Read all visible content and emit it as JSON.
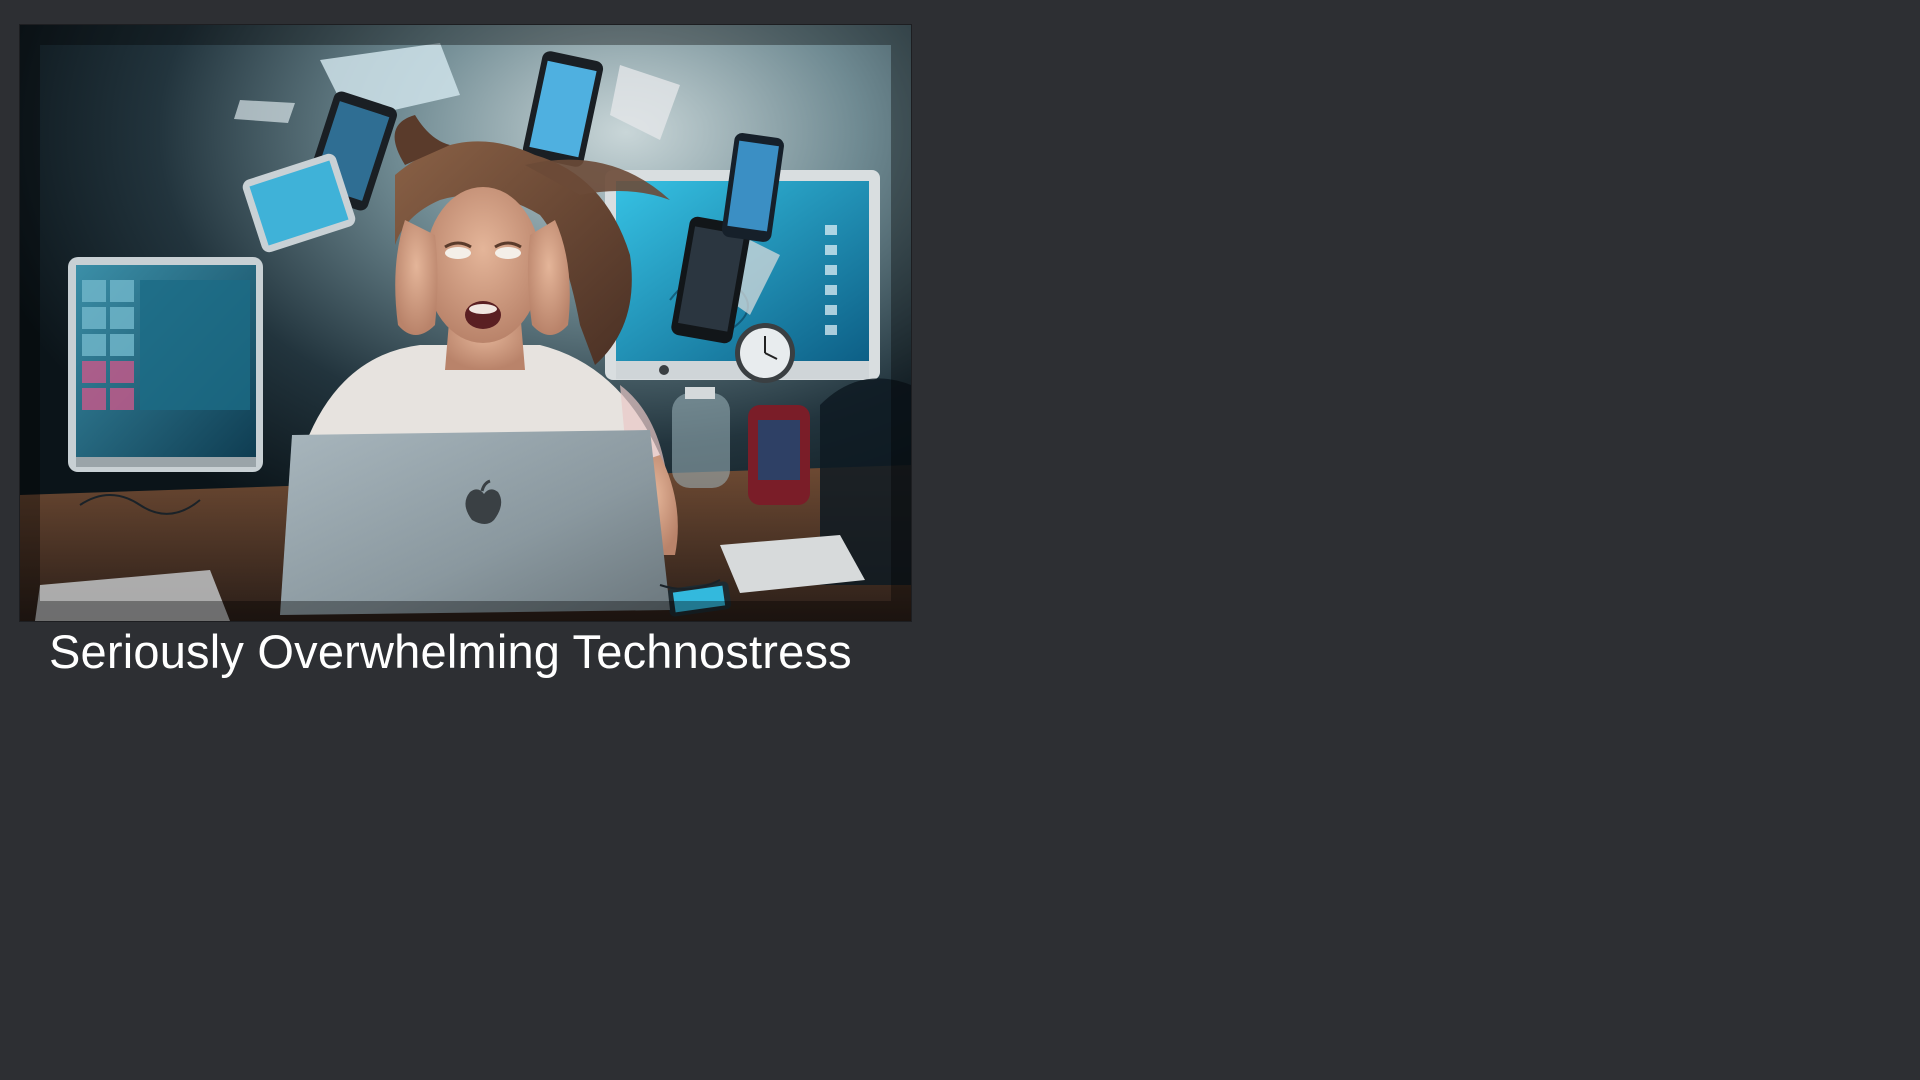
{
  "slide": {
    "caption": "Seriously Overwhelming Technostress",
    "background_color": "#2d2f33"
  },
  "photo": {
    "subject": "stressed-woman-surrounded-by-devices"
  }
}
